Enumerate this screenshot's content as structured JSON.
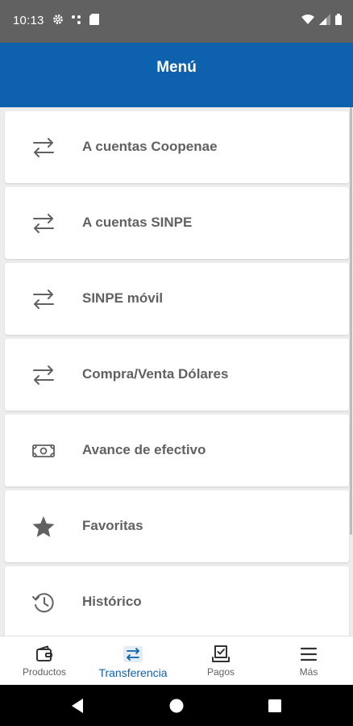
{
  "status_bar": {
    "time": "10:13",
    "left_icons": [
      "settings-icon",
      "signal-dots-icon",
      "sd-card-icon"
    ],
    "right_icons": [
      "wifi-icon",
      "cell-signal-icon",
      "battery-icon"
    ]
  },
  "app_bar": {
    "title": "Menú",
    "color": "#0e62ad"
  },
  "menu": {
    "items": [
      {
        "label": "A cuentas Coopenae",
        "icon": "transfer-arrows-icon"
      },
      {
        "label": "A cuentas SINPE",
        "icon": "transfer-arrows-icon"
      },
      {
        "label": "SINPE móvil",
        "icon": "transfer-arrows-icon"
      },
      {
        "label": "Compra/Venta Dólares",
        "icon": "transfer-arrows-icon"
      },
      {
        "label": "Avance de efectivo",
        "icon": "cash-icon"
      },
      {
        "label": "Favoritas",
        "icon": "star-icon"
      },
      {
        "label": "Histórico",
        "icon": "history-icon"
      }
    ]
  },
  "bottom_nav": {
    "items": [
      {
        "label": "Productos",
        "icon": "wallet-icon",
        "active": false
      },
      {
        "label": "Transferencia",
        "icon": "transfer-icon",
        "active": true
      },
      {
        "label": "Pagos",
        "icon": "payment-icon",
        "active": false
      },
      {
        "label": "Más",
        "icon": "menu-icon",
        "active": false
      }
    ]
  },
  "system_nav": [
    "back-icon",
    "home-icon",
    "recents-icon"
  ],
  "colors": {
    "accent": "#0e62ad",
    "text_gray": "#616161",
    "status_bar": "#616161"
  }
}
